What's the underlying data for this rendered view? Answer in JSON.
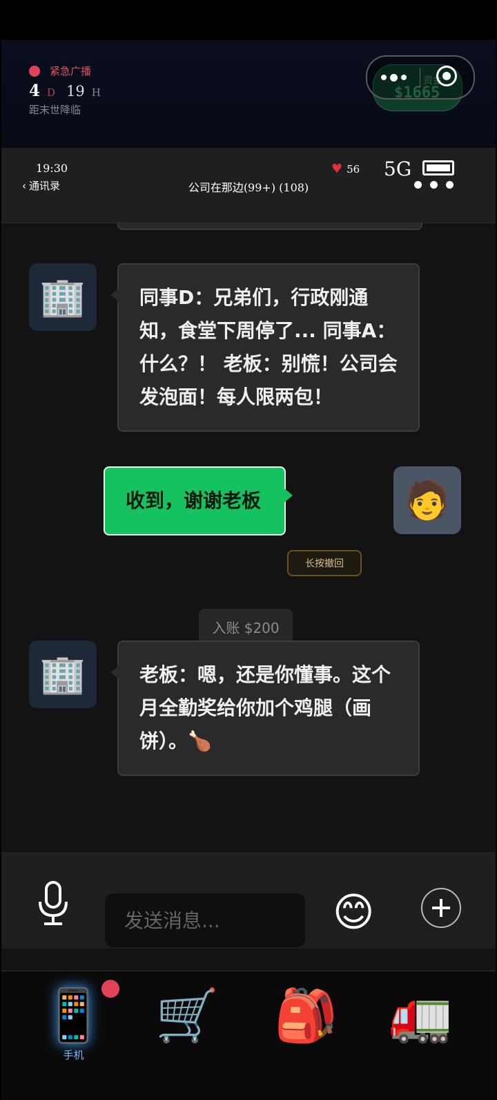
{
  "header": {
    "broadcast_label": "紧急广播",
    "countdown_days": "4",
    "countdown_day_unit": "D",
    "countdown_hours": "19",
    "countdown_hour_unit": "H",
    "countdown_caption": "距末世降临",
    "funds_label": "资金",
    "funds_value": "$1665"
  },
  "phone_nav": {
    "time": "19:30",
    "back_label": "通讯录",
    "chat_title": "公司在那边(99+)  (108)",
    "health_value": "56",
    "signal": "5G"
  },
  "messages": [
    {
      "sender": "other",
      "avatar": "🏢",
      "text": "同事D：兄弟们，行政刚通知，食堂下周停了... 同事A：什么？！ 老板：别慌！公司会发泡面！每人限两包！"
    },
    {
      "sender": "me",
      "avatar": "🧑",
      "text": "收到，谢谢老板",
      "recall_label": "长按撤回"
    },
    {
      "sender": "system",
      "text": "入账 $200"
    },
    {
      "sender": "other",
      "avatar": "🏢",
      "text": "老板：嗯，还是你懂事。这个月全勤奖给你加个鸡腿（画饼）。🍗"
    }
  ],
  "input": {
    "placeholder": "发送消息...",
    "emoji": "😊"
  },
  "tabs": [
    {
      "icon": "📱",
      "label": "手机",
      "active": true
    },
    {
      "icon": "🛒",
      "label": ""
    },
    {
      "icon": "🎒",
      "label": ""
    },
    {
      "icon": "🚛",
      "label": ""
    }
  ],
  "colors": {
    "accent_green": "#16c25f",
    "alert_red": "#e0435a"
  }
}
